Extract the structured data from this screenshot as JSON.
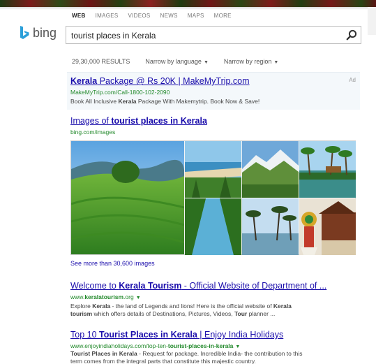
{
  "nav": {
    "items": [
      "WEB",
      "IMAGES",
      "VIDEOS",
      "NEWS",
      "MAPS",
      "MORE"
    ]
  },
  "logo": {
    "text": "bing"
  },
  "search": {
    "query": "tourist places in Kerala"
  },
  "meta": {
    "results": "29,30,000 RESULTS",
    "narrow_language": "Narrow by language",
    "narrow_region": "Narrow by region"
  },
  "ad": {
    "title_bold": "Kerala",
    "title_rest": " Package @ Rs 20K | MakeMyTrip.com",
    "url": "MakeMyTrip.com/Call-1800-102-2090",
    "desc_pre": "Book All Inclusive ",
    "desc_bold": "Kerala",
    "desc_post": " Package With Makemytrip. Book Now & Save!",
    "label": "Ad"
  },
  "images": {
    "title_pre": "Images of ",
    "title_bold": "tourist places in Kerala",
    "url": "bing.com/images",
    "see_more": "See more than 30,600 images"
  },
  "results": [
    {
      "title_pre": "Welcome to ",
      "title_bold": "Kerala Tourism",
      "title_post": " - Official Website of Department of ...",
      "url_pre": "www.",
      "url_bold": "keralatourism",
      "url_post": ".org",
      "desc_1_pre": "Explore ",
      "desc_1_b1": "Kerala",
      "desc_1_mid": " - the land of Legends and lions! Here is the official website of ",
      "desc_1_b2": "Kerala",
      "desc_2_b": "tourism",
      "desc_2_mid": " which offers details of Destinations, Pictures, Videos, ",
      "desc_2_b2": "Tour",
      "desc_2_post": " planner ..."
    },
    {
      "title_pre": "Top 10 ",
      "title_bold": "Tourist Places in Kerala",
      "title_post": " | Enjoy India Holidays",
      "url_pre": "www.enjoyindiaholidays.com/top-ten-",
      "url_bold": "tourist-places-in-kerala",
      "url_post": "",
      "desc_1_pre": "",
      "desc_1_b1": "Tourist Places in Kerala",
      "desc_1_mid": " - Request for package. Incredible India- the contribution to this",
      "desc_1_b2": "",
      "desc_2_b": "",
      "desc_2_mid": "term comes from the integral parts that constitute this majestic country.",
      "desc_2_b2": "",
      "desc_2_post": ""
    }
  ],
  "colors": {
    "link": "#1a0dab",
    "url_green": "#22892b",
    "bing_blue": "#2b9fd9"
  },
  "icons": [
    "search-icon",
    "dropdown-caret-icon"
  ]
}
